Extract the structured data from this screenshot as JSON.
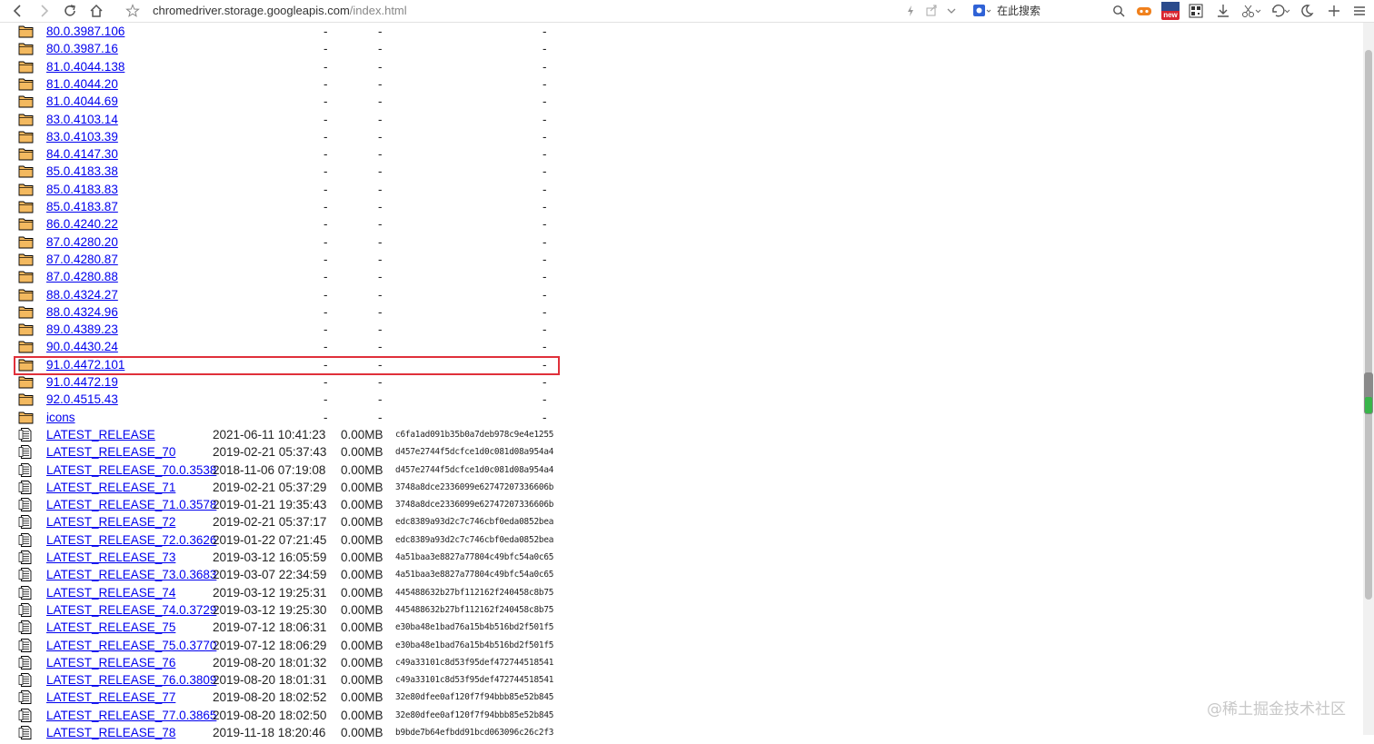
{
  "toolbar": {
    "url_host": "chromedriver.storage.googleapis.com",
    "url_path": "/index.html",
    "search_placeholder": "在此搜索",
    "badge_new": "new"
  },
  "folders": [
    {
      "name": "80.0.3987.106"
    },
    {
      "name": "80.0.3987.16"
    },
    {
      "name": "81.0.4044.138"
    },
    {
      "name": "81.0.4044.20"
    },
    {
      "name": "81.0.4044.69"
    },
    {
      "name": "83.0.4103.14"
    },
    {
      "name": "83.0.4103.39"
    },
    {
      "name": "84.0.4147.30"
    },
    {
      "name": "85.0.4183.38"
    },
    {
      "name": "85.0.4183.83"
    },
    {
      "name": "85.0.4183.87"
    },
    {
      "name": "86.0.4240.22"
    },
    {
      "name": "87.0.4280.20"
    },
    {
      "name": "87.0.4280.87"
    },
    {
      "name": "87.0.4280.88"
    },
    {
      "name": "88.0.4324.27"
    },
    {
      "name": "88.0.4324.96"
    },
    {
      "name": "89.0.4389.23"
    },
    {
      "name": "90.0.4430.24"
    },
    {
      "name": "91.0.4472.101",
      "highlighted": true
    },
    {
      "name": "91.0.4472.19"
    },
    {
      "name": "92.0.4515.43"
    },
    {
      "name": "icons"
    }
  ],
  "files": [
    {
      "name": "LATEST_RELEASE",
      "date": "2021-06-11 10:41:23",
      "size": "0.00MB",
      "hash": "c6fa1ad091b35b0a7deb978c9e4e1255"
    },
    {
      "name": "LATEST_RELEASE_70",
      "date": "2019-02-21 05:37:43",
      "size": "0.00MB",
      "hash": "d457e2744f5dcfce1d0c081d08a954a4"
    },
    {
      "name": "LATEST_RELEASE_70.0.3538",
      "date": "2018-11-06 07:19:08",
      "size": "0.00MB",
      "hash": "d457e2744f5dcfce1d0c081d08a954a4"
    },
    {
      "name": "LATEST_RELEASE_71",
      "date": "2019-02-21 05:37:29",
      "size": "0.00MB",
      "hash": "3748a8dce2336099e62747207336606b"
    },
    {
      "name": "LATEST_RELEASE_71.0.3578",
      "date": "2019-01-21 19:35:43",
      "size": "0.00MB",
      "hash": "3748a8dce2336099e62747207336606b"
    },
    {
      "name": "LATEST_RELEASE_72",
      "date": "2019-02-21 05:37:17",
      "size": "0.00MB",
      "hash": "edc8389a93d2c7c746cbf0eda0852bea"
    },
    {
      "name": "LATEST_RELEASE_72.0.3626",
      "date": "2019-01-22 07:21:45",
      "size": "0.00MB",
      "hash": "edc8389a93d2c7c746cbf0eda0852bea"
    },
    {
      "name": "LATEST_RELEASE_73",
      "date": "2019-03-12 16:05:59",
      "size": "0.00MB",
      "hash": "4a51baa3e8827a77804c49bfc54a0c65"
    },
    {
      "name": "LATEST_RELEASE_73.0.3683",
      "date": "2019-03-07 22:34:59",
      "size": "0.00MB",
      "hash": "4a51baa3e8827a77804c49bfc54a0c65"
    },
    {
      "name": "LATEST_RELEASE_74",
      "date": "2019-03-12 19:25:31",
      "size": "0.00MB",
      "hash": "445488632b27bf112162f240458c8b75"
    },
    {
      "name": "LATEST_RELEASE_74.0.3729",
      "date": "2019-03-12 19:25:30",
      "size": "0.00MB",
      "hash": "445488632b27bf112162f240458c8b75"
    },
    {
      "name": "LATEST_RELEASE_75",
      "date": "2019-07-12 18:06:31",
      "size": "0.00MB",
      "hash": "e30ba48e1bad76a15b4b516bd2f501f5"
    },
    {
      "name": "LATEST_RELEASE_75.0.3770",
      "date": "2019-07-12 18:06:29",
      "size": "0.00MB",
      "hash": "e30ba48e1bad76a15b4b516bd2f501f5"
    },
    {
      "name": "LATEST_RELEASE_76",
      "date": "2019-08-20 18:01:32",
      "size": "0.00MB",
      "hash": "c49a33101c8d53f95def472744518541"
    },
    {
      "name": "LATEST_RELEASE_76.0.3809",
      "date": "2019-08-20 18:01:31",
      "size": "0.00MB",
      "hash": "c49a33101c8d53f95def472744518541"
    },
    {
      "name": "LATEST_RELEASE_77",
      "date": "2019-08-20 18:02:52",
      "size": "0.00MB",
      "hash": "32e80dfee0af120f7f94bbb85e52b845"
    },
    {
      "name": "LATEST_RELEASE_77.0.3865",
      "date": "2019-08-20 18:02:50",
      "size": "0.00MB",
      "hash": "32e80dfee0af120f7f94bbb85e52b845"
    },
    {
      "name": "LATEST_RELEASE_78",
      "date": "2019-11-18 18:20:46",
      "size": "0.00MB",
      "hash": "b9bde7b64efbdd91bcd063096c26c2f3"
    }
  ],
  "watermark": "@稀土掘金技术社区",
  "colors": {
    "link": "#0000ee",
    "highlight_border": "#e0303a",
    "folder": "#f3b95f"
  }
}
